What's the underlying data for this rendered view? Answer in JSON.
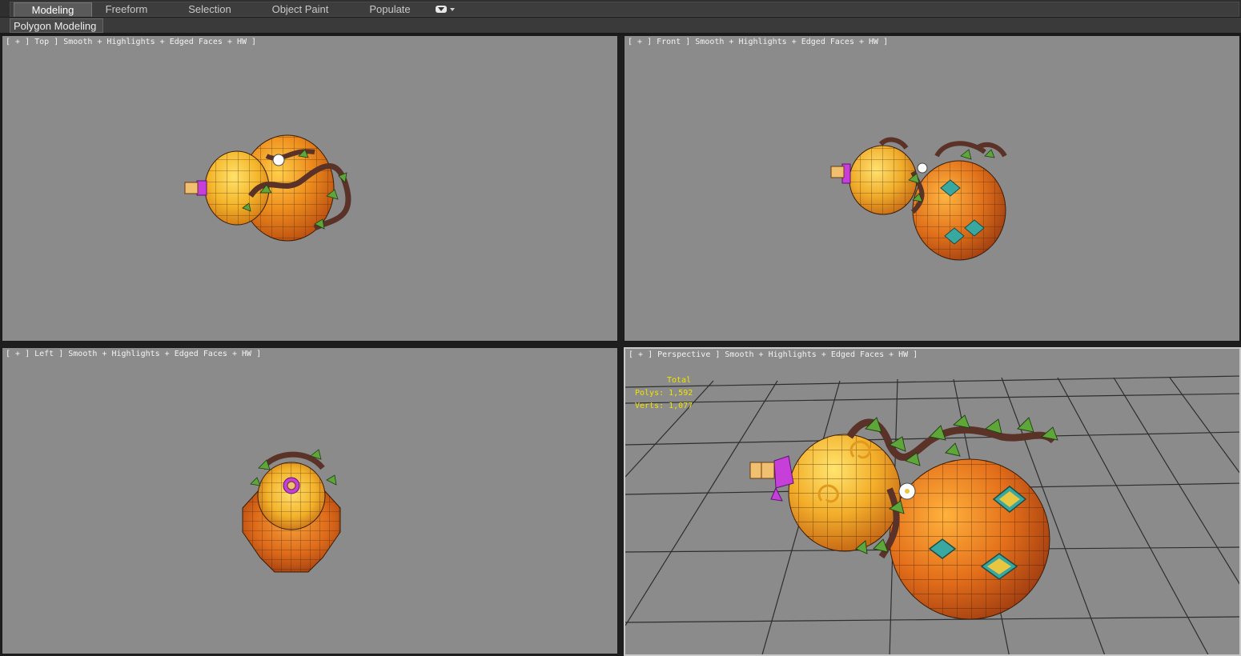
{
  "ribbon": {
    "tabs": [
      {
        "label": "Modeling",
        "active": true
      },
      {
        "label": "Freeform",
        "active": false
      },
      {
        "label": "Selection",
        "active": false
      },
      {
        "label": "Object Paint",
        "active": false
      },
      {
        "label": "Populate",
        "active": false
      }
    ],
    "panel_label": "Polygon Modeling"
  },
  "viewports": {
    "top": {
      "label": "[ + ] Top ] Smooth + Highlights + Edged Faces + HW ]"
    },
    "front": {
      "label": "[ + ] Front ] Smooth + Highlights + Edged Faces + HW ]"
    },
    "left": {
      "label": "[ + ] Left ] Smooth + Highlights + Edged Faces + HW ]"
    },
    "perspective": {
      "label": "[ + ] Perspective ] Smooth + Highlights + Edged Faces + HW ]",
      "stats": {
        "title": "Total",
        "polys": "Polys: 1,592",
        "verts": "Verts: 1,077"
      }
    }
  },
  "colors": {
    "viewport_bg": "#8b8b8b",
    "stats_text": "#f2e400",
    "gourd_orange": "#e9821c",
    "gourd_yellow": "#f4bd2a",
    "ribbon_purple": "#c63fd8",
    "leaf_green": "#5ea63a",
    "vine_brown": "#5a3228"
  }
}
